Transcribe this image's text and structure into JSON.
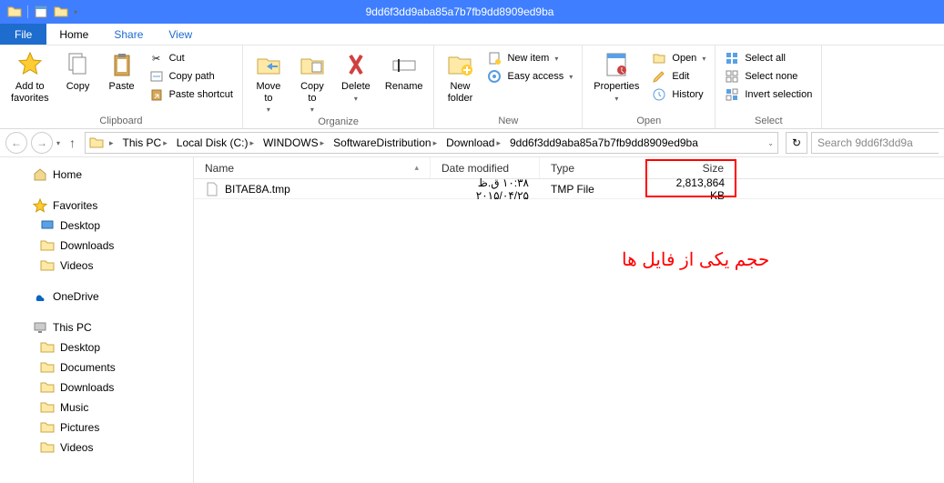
{
  "window": {
    "title": "9dd6f3dd9aba85a7b7fb9dd8909ed9ba"
  },
  "tabs": {
    "file": "File",
    "home": "Home",
    "share": "Share",
    "view": "View"
  },
  "ribbon": {
    "clipboard": {
      "label": "Clipboard",
      "add_favorites": "Add to\nfavorites",
      "copy": "Copy",
      "paste": "Paste",
      "cut": "Cut",
      "copy_path": "Copy path",
      "paste_shortcut": "Paste shortcut"
    },
    "organize": {
      "label": "Organize",
      "move_to": "Move\nto",
      "copy_to": "Copy\nto",
      "delete": "Delete",
      "rename": "Rename"
    },
    "new_group": {
      "label": "New",
      "new_folder": "New\nfolder",
      "new_item": "New item",
      "easy_access": "Easy access"
    },
    "open_group": {
      "label": "Open",
      "properties": "Properties",
      "open": "Open",
      "edit": "Edit",
      "history": "History"
    },
    "select_group": {
      "label": "Select",
      "select_all": "Select all",
      "select_none": "Select none",
      "invert": "Invert selection"
    }
  },
  "breadcrumbs": [
    "This PC",
    "Local Disk (C:)",
    "WINDOWS",
    "SoftwareDistribution",
    "Download",
    "9dd6f3dd9aba85a7b7fb9dd8909ed9ba"
  ],
  "search_placeholder": "Search 9dd6f3dd9a",
  "nav": {
    "home": "Home",
    "favorites": "Favorites",
    "fav_desktop": "Desktop",
    "fav_downloads": "Downloads",
    "fav_videos": "Videos",
    "onedrive": "OneDrive",
    "thispc": "This PC",
    "pc_desktop": "Desktop",
    "pc_documents": "Documents",
    "pc_downloads": "Downloads",
    "pc_music": "Music",
    "pc_pictures": "Pictures",
    "pc_videos": "Videos"
  },
  "columns": {
    "name": "Name",
    "date": "Date modified",
    "type": "Type",
    "size": "Size"
  },
  "files": [
    {
      "name": "BITAE8A.tmp",
      "date": "۱۰:۳۸ ق.ظ ۲۰۱۵/۰۴/۲۵",
      "type": "TMP File",
      "size": "2,813,864 KB"
    }
  ],
  "annotation": "حجم یکی از فایل ها"
}
